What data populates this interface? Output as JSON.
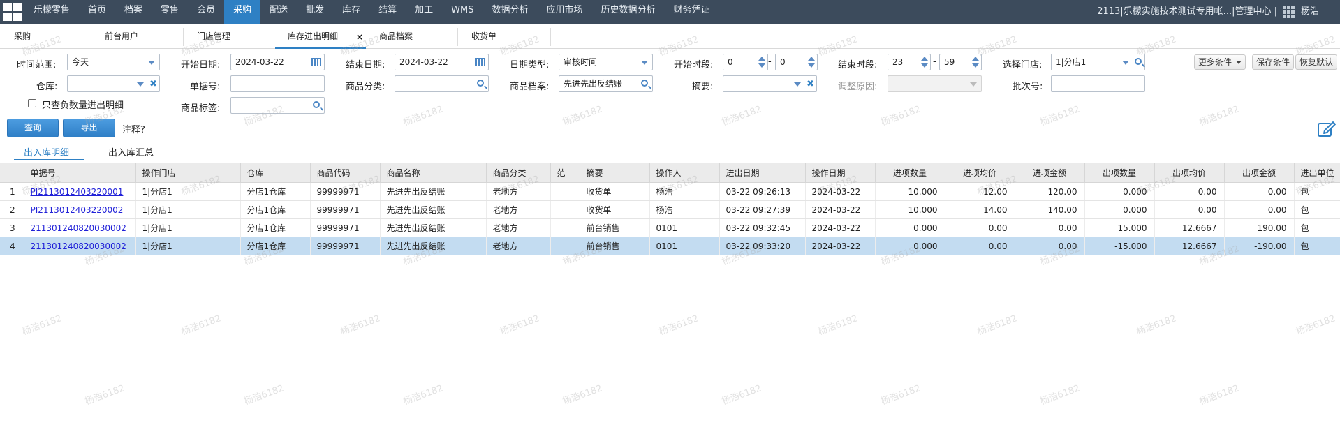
{
  "nav": {
    "items": [
      "乐檬零售",
      "首页",
      "档案",
      "零售",
      "会员",
      "采购",
      "配送",
      "批发",
      "库存",
      "结算",
      "加工",
      "WMS",
      "数据分析",
      "应用市场",
      "历史数据分析",
      "财务凭证"
    ],
    "active_index": 5,
    "account": "2113|乐檬实施技术测试专用帐...|管理中心 |",
    "user": "杨浩"
  },
  "tabs": {
    "items": [
      "采购",
      "前台用户",
      "门店管理",
      "库存进出明细",
      "商品档案",
      "收货单"
    ],
    "active_index": 3,
    "close_glyph": "×"
  },
  "filters": {
    "time_range_label": "时间范围:",
    "time_range_value": "今天",
    "start_date_label": "开始日期:",
    "start_date_value": "2024-03-22",
    "end_date_label": "结束日期:",
    "end_date_value": "2024-03-22",
    "date_type_label": "日期类型:",
    "date_type_value": "审核时间",
    "start_period_label": "开始时段:",
    "start_hour": "0",
    "start_minute": "0",
    "end_period_label": "结束时段:",
    "end_hour": "23",
    "end_minute": "59",
    "store_label": "选择门店:",
    "store_value": "1|分店1",
    "warehouse_label": "仓库:",
    "warehouse_value": "",
    "doc_no_label": "单据号:",
    "doc_no_value": "",
    "category_label": "商品分类:",
    "category_value": "",
    "product_label": "商品档案:",
    "product_value": "先进先出反结账",
    "summary_label": "摘要:",
    "summary_value": "",
    "adjust_reason_label": "调整原因:",
    "adjust_reason_value": "",
    "batch_label": "批次号:",
    "batch_value": "",
    "tag_label": "商品标签:",
    "tag_value": "",
    "negative_only_label": "只查负数量进出明细",
    "negative_only_checked": false,
    "dash": "-"
  },
  "buttons": {
    "more_conditions": "更多条件",
    "save_conditions": "保存条件",
    "restore_default": "恢复默认",
    "query": "查询",
    "export": "导出",
    "note": "注释?"
  },
  "subtabs": {
    "items": [
      "出入库明细",
      "出入库汇总"
    ],
    "active_index": 0
  },
  "table": {
    "columns": [
      "",
      "单据号",
      "操作门店",
      "仓库",
      "商品代码",
      "商品名称",
      "商品分类",
      "范",
      "摘要",
      "操作人",
      "进出日期",
      "操作日期",
      "进项数量",
      "进项均价",
      "进项金额",
      "出项数量",
      "出项均价",
      "出项金额",
      "进出单位"
    ],
    "rows": [
      [
        "1",
        "PI2113012403220001",
        "1|分店1",
        "分店1仓库",
        "99999971",
        "先进先出反结账",
        "老地方",
        "",
        "收货单",
        "杨浩",
        "03-22 09:26:13",
        "2024-03-22",
        "10.000",
        "12.00",
        "120.00",
        "0.000",
        "0.00",
        "0.00",
        "包"
      ],
      [
        "2",
        "PI2113012403220002",
        "1|分店1",
        "分店1仓库",
        "99999971",
        "先进先出反结账",
        "老地方",
        "",
        "收货单",
        "杨浩",
        "03-22 09:27:39",
        "2024-03-22",
        "10.000",
        "14.00",
        "140.00",
        "0.000",
        "0.00",
        "0.00",
        "包"
      ],
      [
        "3",
        "211301240820030002",
        "1|分店1",
        "分店1仓库",
        "99999971",
        "先进先出反结账",
        "老地方",
        "",
        "前台销售",
        "0101",
        "03-22 09:32:45",
        "2024-03-22",
        "0.000",
        "0.00",
        "0.00",
        "15.000",
        "12.6667",
        "190.00",
        "包"
      ],
      [
        "4",
        "211301240820030002",
        "1|分店1",
        "分店1仓库",
        "99999971",
        "先进先出反结账",
        "老地方",
        "",
        "前台销售",
        "0101",
        "03-22 09:33:20",
        "2024-03-22",
        "0.000",
        "0.00",
        "0.00",
        "-15.000",
        "12.6667",
        "-190.00",
        "包"
      ]
    ],
    "selected_row": 3
  },
  "watermark": "杨浩6182",
  "colors": {
    "nav_bg": "#3c4b5c",
    "accent": "#2e80c4",
    "in_value": "#1a8f1a",
    "out_value": "#e0142b",
    "selected_row": "#c3dcf1"
  }
}
